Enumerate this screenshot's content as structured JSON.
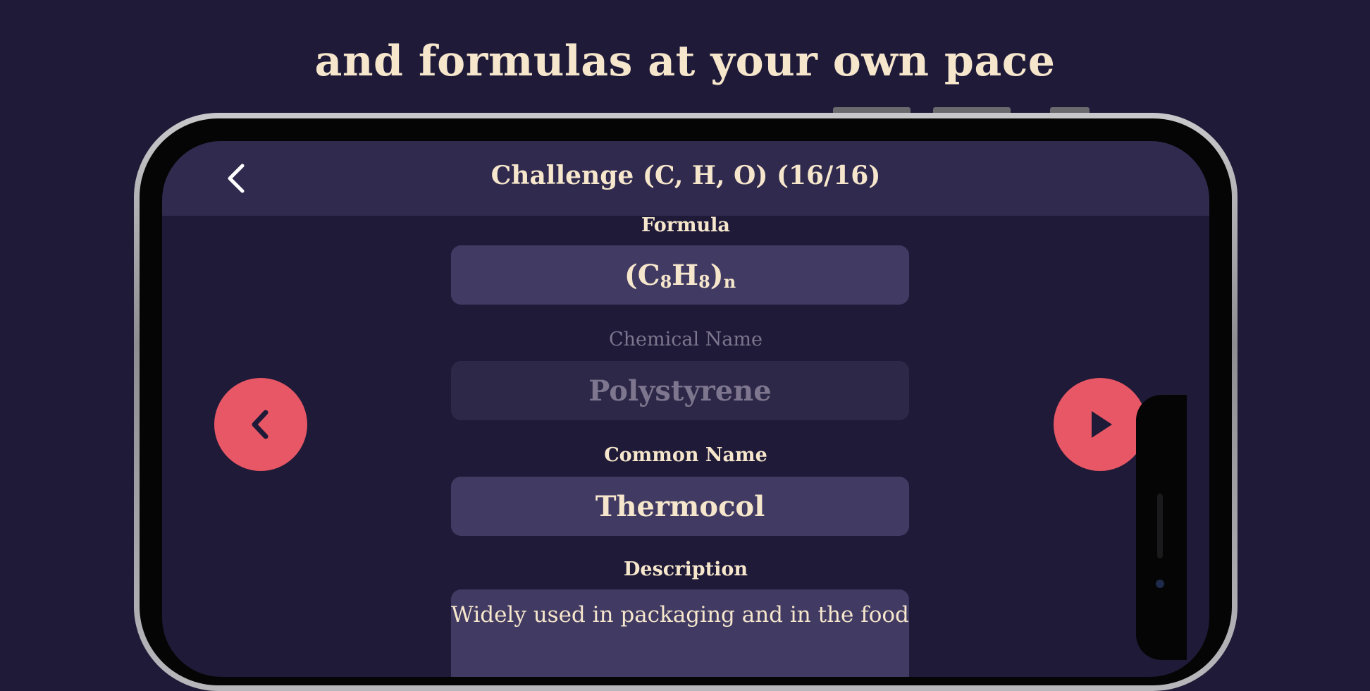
{
  "promo": {
    "caption": "and formulas at your own pace"
  },
  "header": {
    "title": "Challenge (C, H, O) (16/16)",
    "back_icon": "chevron-left-icon"
  },
  "formula": {
    "label": "Formula",
    "value_parts": [
      {
        "text": "(C",
        "sub": false
      },
      {
        "text": "8",
        "sub": true
      },
      {
        "text": "H",
        "sub": false
      },
      {
        "text": "8",
        "sub": true
      },
      {
        "text": ")",
        "sub": false
      },
      {
        "text": "n",
        "sub": true
      }
    ]
  },
  "chemical_name": {
    "label": "Chemical Name",
    "value": "Polystyrene"
  },
  "common_name": {
    "label": "Common Name",
    "value": "Thermocol"
  },
  "description": {
    "label": "Description",
    "value": "Widely used in packaging and in the food-"
  },
  "nav": {
    "prev_icon": "chevron-left-icon",
    "next_icon": "play-icon",
    "button_color": "#e85765"
  },
  "colors": {
    "background": "#1e1a38",
    "header": "#302a4e",
    "field": "#413b63",
    "text": "#f6e6cc",
    "dim_text": "#7d768e"
  }
}
